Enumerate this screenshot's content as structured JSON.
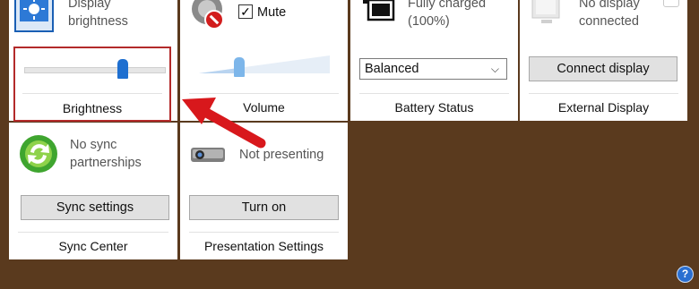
{
  "tiles": {
    "display": {
      "text": "Display\nbrightness",
      "label": "Brightness"
    },
    "volume": {
      "mute_label": "Mute",
      "mute_checked": true,
      "label": "Volume"
    },
    "battery": {
      "status_text": "Fully charged\n(100%)",
      "plan": "Balanced",
      "label": "Battery Status"
    },
    "external": {
      "status_text": "No display\nconnected",
      "button": "Connect display",
      "label": "External Display"
    },
    "sync": {
      "status_text": "No sync\npartnerships",
      "button": "Sync settings",
      "label": "Sync Center"
    },
    "presentation": {
      "status_text": "Not presenting",
      "button": "Turn on",
      "label": "Presentation Settings"
    }
  },
  "brightness_level": 0.68,
  "volume_level": 0.3,
  "help_glyph": "?",
  "colors": {
    "background": "#5a3a1e",
    "highlight_border": "#b32a2a",
    "arrow": "#d8181c",
    "slider_thumb": "#1e6fd0"
  }
}
